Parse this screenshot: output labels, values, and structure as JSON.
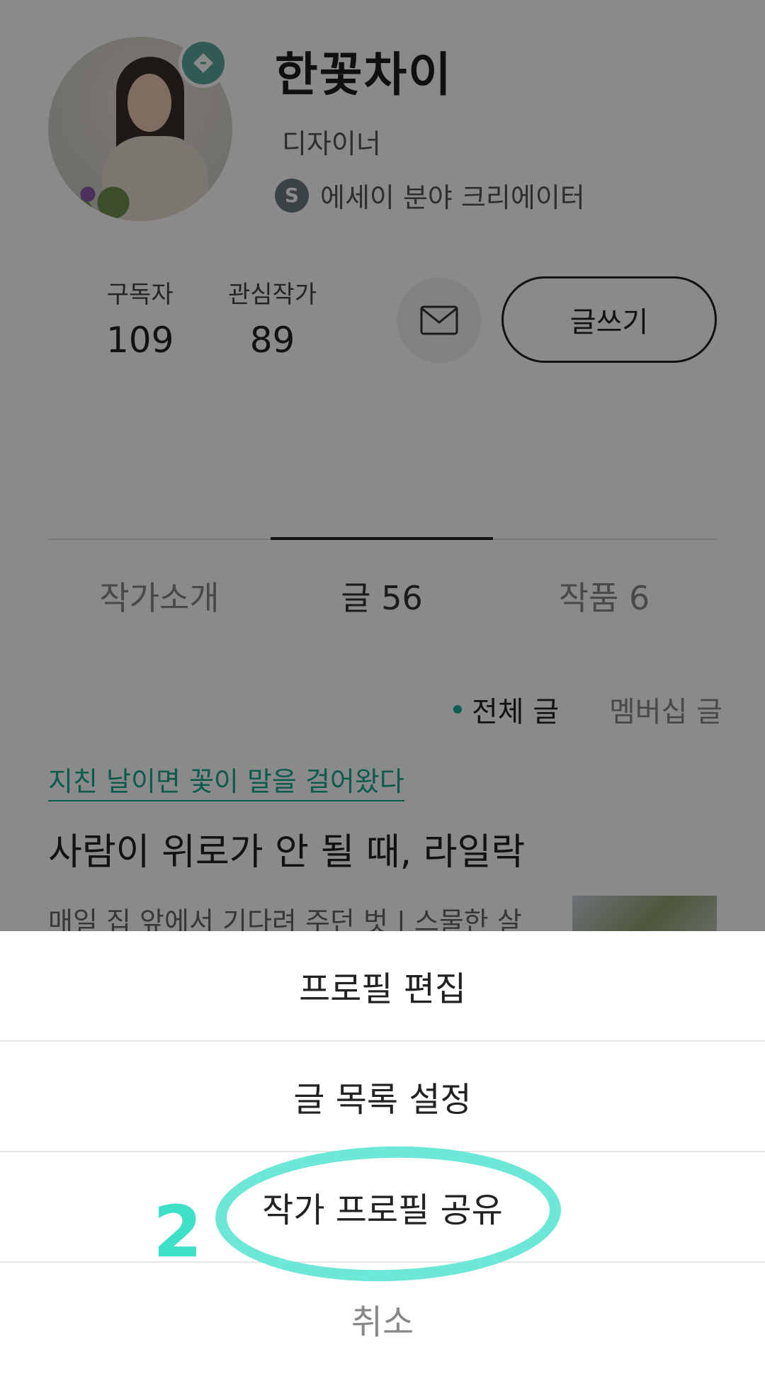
{
  "profile": {
    "name": "한꽃차이",
    "role": "디자이너",
    "creator_badge": "S",
    "creator_label": "에세이 분야 크리에이터",
    "stats": {
      "subscribers_label": "구독자",
      "subscribers_value": "109",
      "following_label": "관심작가",
      "following_value": "89"
    },
    "write_button": "글쓰기"
  },
  "tabs": [
    {
      "label": "작가소개",
      "active": false
    },
    {
      "label": "글 56",
      "active": true
    },
    {
      "label": "작품 6",
      "active": false
    }
  ],
  "filters": {
    "all": "전체 글",
    "member": "멤버십 글"
  },
  "post": {
    "magazine": "지친 날이면 꽃이 말을 걸어왔다",
    "title": "사람이 위로가 안 될 때, 라일락",
    "excerpt": "매일 집 앞에서 기다려 주던 벗 | 스물한 살"
  },
  "action_sheet": {
    "items": [
      "프로필 편집",
      "글 목록 설정",
      "작가 프로필 공유"
    ],
    "cancel": "취소"
  },
  "annotation": {
    "step_number": "2"
  },
  "colors": {
    "accent": "#18b09a",
    "highlight": "#6ee8d6",
    "step_number": "#3fe0c8"
  }
}
